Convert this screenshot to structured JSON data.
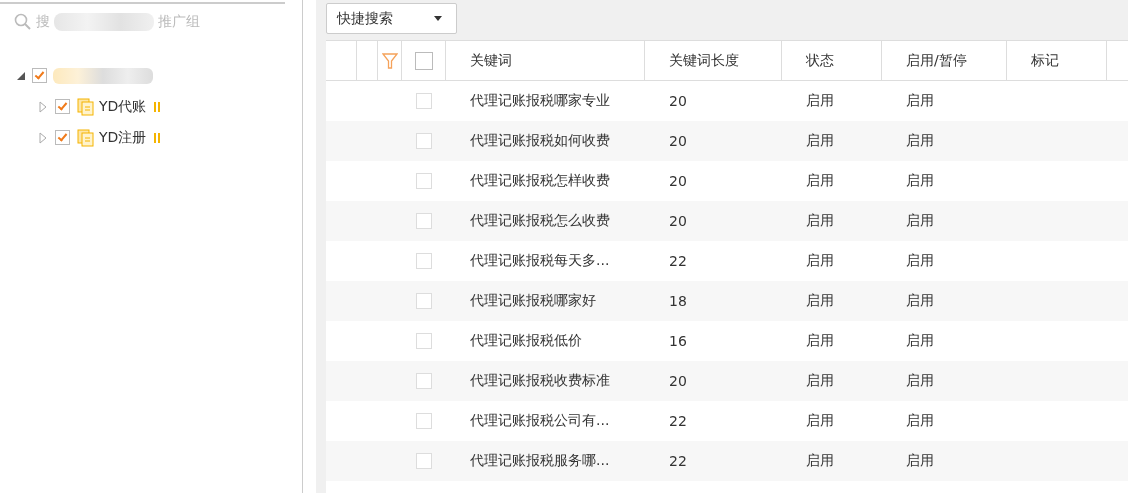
{
  "sidebar": {
    "search": {
      "placeholder_start": "搜",
      "placeholder_end": "推广组"
    },
    "tree": [
      {
        "expanded": true,
        "checked": true,
        "children": [
          {
            "label": "YD代账",
            "expanded": false,
            "checked": true
          },
          {
            "label": "YD注册",
            "expanded": false,
            "checked": true
          }
        ]
      }
    ]
  },
  "toolbar": {
    "quick_search": "快捷搜索"
  },
  "table": {
    "header_checked": false,
    "columns": [
      "关键词",
      "关键词长度",
      "状态",
      "启用/暂停",
      "标记"
    ],
    "rows": [
      {
        "checked": false,
        "cells": [
          "代理记账报税哪家专业",
          "20",
          "启用",
          "启用",
          ""
        ]
      },
      {
        "checked": false,
        "cells": [
          "代理记账报税如何收费",
          "20",
          "启用",
          "启用",
          ""
        ]
      },
      {
        "checked": false,
        "cells": [
          "代理记账报税怎样收费",
          "20",
          "启用",
          "启用",
          ""
        ]
      },
      {
        "checked": false,
        "cells": [
          "代理记账报税怎么收费",
          "20",
          "启用",
          "启用",
          ""
        ]
      },
      {
        "checked": false,
        "cells": [
          "代理记账报税每天多...",
          "22",
          "启用",
          "启用",
          ""
        ]
      },
      {
        "checked": false,
        "cells": [
          "代理记账报税哪家好",
          "18",
          "启用",
          "启用",
          ""
        ]
      },
      {
        "checked": false,
        "cells": [
          "代理记账报税低价",
          "16",
          "启用",
          "启用",
          ""
        ]
      },
      {
        "checked": false,
        "cells": [
          "代理记账报税收费标准",
          "20",
          "启用",
          "启用",
          ""
        ]
      },
      {
        "checked": false,
        "cells": [
          "代理记账报税公司有...",
          "22",
          "启用",
          "启用",
          ""
        ]
      },
      {
        "checked": false,
        "cells": [
          "代理记账报税服务哪...",
          "22",
          "启用",
          "启用",
          ""
        ]
      }
    ]
  }
}
